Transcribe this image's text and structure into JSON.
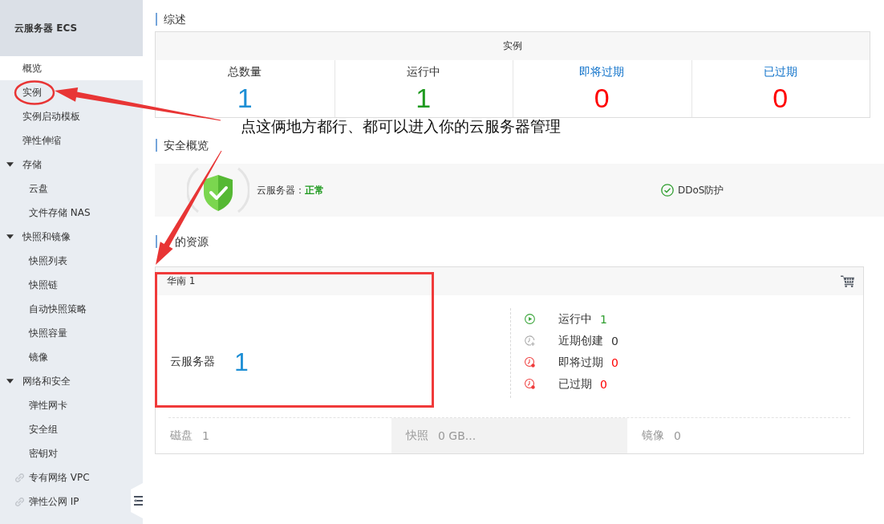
{
  "sidebar": {
    "title": "云服务器 ECS",
    "items": [
      {
        "label": "概览",
        "kind": "item",
        "selected": true
      },
      {
        "label": "实例",
        "kind": "item",
        "selected": false
      },
      {
        "label": "实例启动模板",
        "kind": "item",
        "selected": false
      },
      {
        "label": "弹性伸缩",
        "kind": "item",
        "selected": false
      },
      {
        "label": "存储",
        "kind": "group",
        "expanded": true,
        "children": [
          {
            "label": "云盘",
            "selected": false
          },
          {
            "label": "文件存储 NAS",
            "selected": false
          }
        ]
      },
      {
        "label": "快照和镜像",
        "kind": "group",
        "expanded": true,
        "children": [
          {
            "label": "快照列表",
            "selected": false
          },
          {
            "label": "快照链",
            "selected": false
          },
          {
            "label": "自动快照策略",
            "selected": false
          },
          {
            "label": "快照容量",
            "selected": false
          },
          {
            "label": "镜像",
            "selected": false
          }
        ]
      },
      {
        "label": "网络和安全",
        "kind": "group",
        "expanded": true,
        "children": [
          {
            "label": "弹性网卡",
            "selected": false
          },
          {
            "label": "安全组",
            "selected": false
          },
          {
            "label": "密钥对",
            "selected": false
          }
        ]
      },
      {
        "label": "专有网络 VPC",
        "kind": "link",
        "selected": false
      },
      {
        "label": "弹性公网 IP",
        "kind": "link",
        "selected": false
      }
    ]
  },
  "overview": {
    "title": "综述",
    "header": "实例",
    "stats": [
      {
        "label": "总数量",
        "link": false,
        "value": "1",
        "color": "#1e8fd5"
      },
      {
        "label": "运行中",
        "link": false,
        "value": "1",
        "color": "#1f9a1f"
      },
      {
        "label": "即将过期",
        "link": true,
        "value": "0",
        "color": "#ff0000"
      },
      {
        "label": "已过期",
        "link": true,
        "value": "0",
        "color": "#ff0000"
      }
    ]
  },
  "annotation": {
    "text": "点这俩地方都行、都可以进入你的云服务器管理"
  },
  "security": {
    "title": "安全概览",
    "server_label": "云服务器：",
    "status": "正常",
    "protection": "DDoS防护"
  },
  "resources": {
    "title": "的资源",
    "region": "华南 1",
    "server_label": "云服务器",
    "server_count": "1",
    "statuses": [
      {
        "kind": "running",
        "label": "运行中",
        "value": "1",
        "color": "#2f9e2f"
      },
      {
        "kind": "recent",
        "label": "近期创建",
        "value": "0",
        "color": "#333333"
      },
      {
        "kind": "expiring",
        "label": "即将过期",
        "value": "0",
        "color": "#ff0000"
      },
      {
        "kind": "expired",
        "label": "已过期",
        "value": "0",
        "color": "#ff0000"
      }
    ],
    "summary": [
      {
        "label": "磁盘",
        "value": "1",
        "highlighted": false
      },
      {
        "label": "快照",
        "value": "0 GB...",
        "highlighted": true
      },
      {
        "label": "镜像",
        "value": "0",
        "highlighted": false
      }
    ]
  }
}
